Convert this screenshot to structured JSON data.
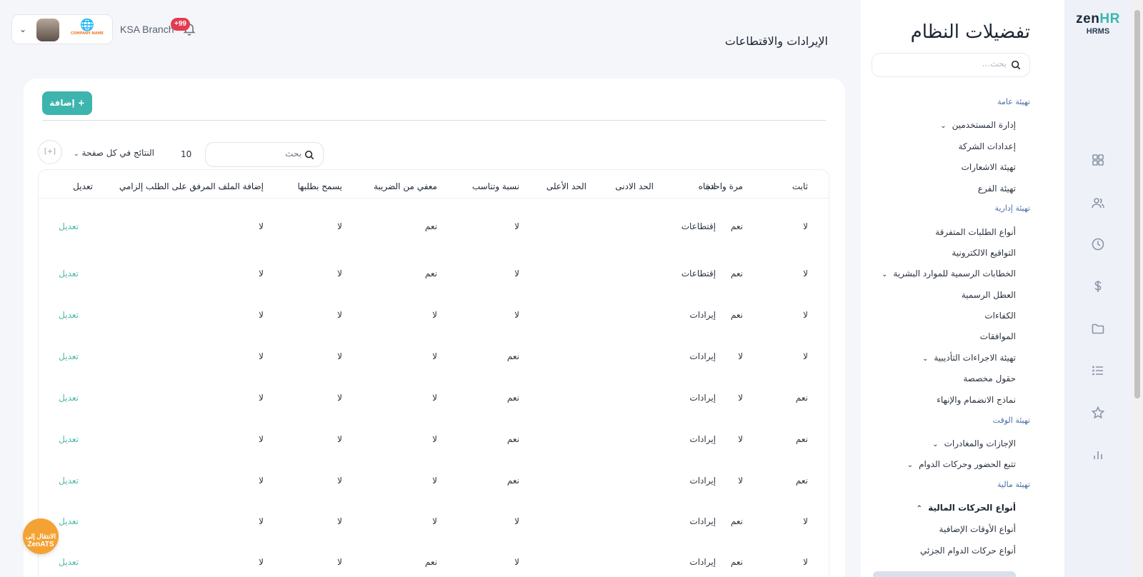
{
  "app": {
    "brand_main": "zen",
    "brand_accent": "HR",
    "brand_sub": "HRMS"
  },
  "rail_icons": [
    "grid-icon",
    "users-icon",
    "clock-icon",
    "dollar-icon",
    "folder-icon",
    "list-icon",
    "star-icon",
    "bar-chart-icon"
  ],
  "sidebar": {
    "title": "تفضيلات النظام",
    "search_placeholder": "بحث...",
    "sections": [
      {
        "label": "تهيئة عامة"
      },
      {
        "label": "تهيئة إدارية"
      },
      {
        "label": "تهيئة الوقت"
      },
      {
        "label": "تهيئة مالية"
      }
    ],
    "items": [
      {
        "label": "إدارة المستخدمين",
        "chevron": "⌄"
      },
      {
        "label": "إعدادات الشركة"
      },
      {
        "label": "تهيئة الاشعارات"
      },
      {
        "label": "تهيئة الفرع"
      },
      {
        "label": "أنواع الطلبات المتفرقة"
      },
      {
        "label": "التواقيع الالكترونية"
      },
      {
        "label": "الخطابات الرسمية للموارد البشرية",
        "chevron": "⌄"
      },
      {
        "label": "العطل الرسمية"
      },
      {
        "label": "الكفاءات"
      },
      {
        "label": "الموافقات"
      },
      {
        "label": "تهيئة الاجراءات التأديبية",
        "chevron": "⌄"
      },
      {
        "label": "حقول مخصصة"
      },
      {
        "label": "نماذج الانضمام والإنهاء"
      },
      {
        "label": "الإجازات والمغادرات",
        "chevron": "⌄"
      },
      {
        "label": "تتبع الحضور وحركات الدوام",
        "chevron": "⌄"
      },
      {
        "label": "أنواع الحركات المالية",
        "chevron": "⌃"
      },
      {
        "label": "أنواع الأوقات الإضافية"
      },
      {
        "label": "أنواع حركات الدوام الجزئي"
      }
    ]
  },
  "header": {
    "page_title": "الإيرادات والاقتطاعات",
    "branch": "KSA Branch",
    "notifications_badge": "+99",
    "company_logo_text": "COMPANY NAME"
  },
  "toolbar": {
    "add_label": "+ إضافة",
    "search_placeholder": "بحث",
    "per_page_value": "10",
    "per_page_label": "النتائج في كل صفحة",
    "columns_icon": "[+]"
  },
  "table": {
    "headers": [
      "ثابت",
      "مرة واحدة",
      "اتجاه",
      "الحد الادنى",
      "الحد الأعلى",
      "نسبة وتناسب",
      "معفي من الضريبة",
      "يسمح بطلبها",
      "إضافة الملف المرفق على الطلب إلزامي",
      "تعديل"
    ],
    "rows": [
      [
        "لا",
        "نعم",
        "إقتطاعات",
        "",
        "",
        "لا",
        "نعم",
        "لا",
        "لا",
        "تعديل"
      ],
      [
        "لا",
        "نعم",
        "إقتطاعات",
        "",
        "",
        "لا",
        "نعم",
        "لا",
        "لا",
        "تعديل"
      ],
      [
        "لا",
        "نعم",
        "إيرادات",
        "",
        "",
        "لا",
        "لا",
        "لا",
        "لا",
        "تعديل"
      ],
      [
        "لا",
        "لا",
        "إيرادات",
        "",
        "",
        "نعم",
        "لا",
        "لا",
        "لا",
        "تعديل"
      ],
      [
        "نعم",
        "لا",
        "إيرادات",
        "",
        "",
        "نعم",
        "لا",
        "لا",
        "لا",
        "تعديل"
      ],
      [
        "نعم",
        "لا",
        "إيرادات",
        "",
        "",
        "نعم",
        "لا",
        "لا",
        "لا",
        "تعديل"
      ],
      [
        "نعم",
        "لا",
        "إيرادات",
        "",
        "",
        "نعم",
        "لا",
        "لا",
        "لا",
        "تعديل"
      ],
      [
        "لا",
        "نعم",
        "إيرادات",
        "",
        "",
        "لا",
        "لا",
        "لا",
        "لا",
        "تعديل"
      ],
      [
        "لا",
        "نعم",
        "إيرادات",
        "",
        "",
        "لا",
        "نعم",
        "لا",
        "لا",
        "تعديل"
      ]
    ]
  },
  "fab": {
    "line1": "الانتقال إلى",
    "line2": "ZenATS"
  },
  "colors": {
    "accent": "#3db4ad",
    "edit_link": "#4bb8a6",
    "badge": "#e23c4e",
    "fab": "#f4a234"
  }
}
